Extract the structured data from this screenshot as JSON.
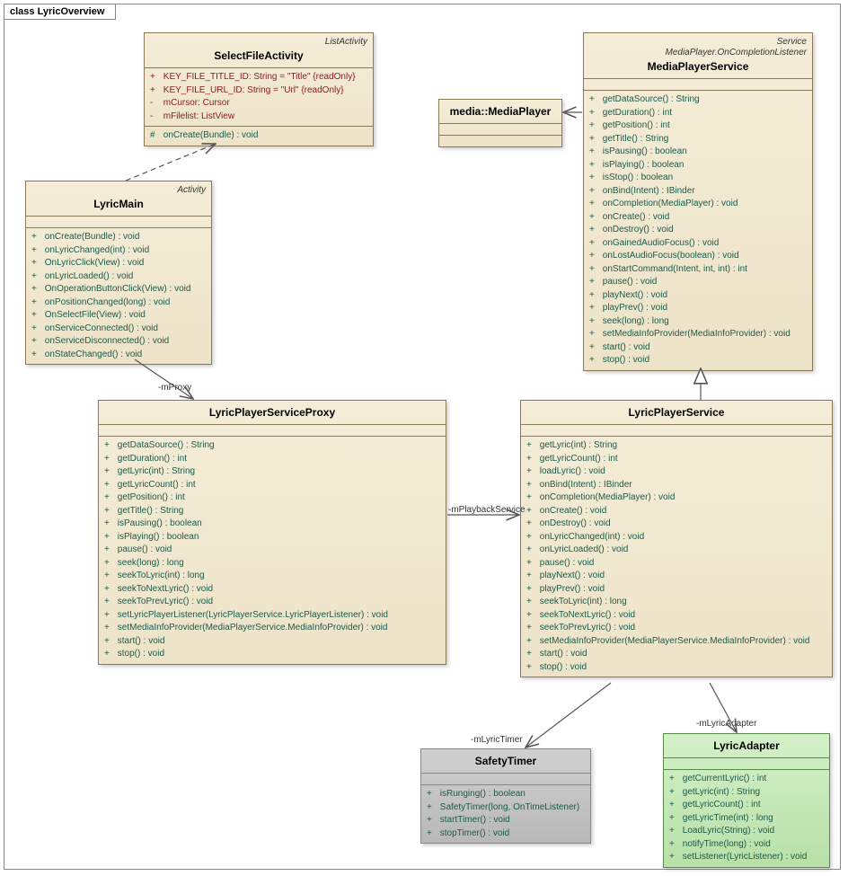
{
  "frame": {
    "title": "class LyricOverview"
  },
  "SelectFileActivity": {
    "stereo": "ListActivity",
    "name": "SelectFileActivity",
    "attrs": [
      {
        "vis": "+",
        "txt": "KEY_FILE_TITLE_ID:  String = \"Title\" {readOnly}",
        "red": true
      },
      {
        "vis": "+",
        "txt": "KEY_FILE_URL_ID:  String = \"Url\" {readOnly}",
        "red": true
      },
      {
        "vis": "-",
        "txt": "mCursor:  Cursor",
        "red": true
      },
      {
        "vis": "-",
        "txt": "mFilelist:  ListView",
        "red": true
      }
    ],
    "ops": [
      {
        "vis": "#",
        "txt": "onCreate(Bundle) : void"
      }
    ]
  },
  "LyricMain": {
    "stereo": "Activity",
    "name": "LyricMain",
    "ops": [
      {
        "vis": "+",
        "txt": "onCreate(Bundle) : void"
      },
      {
        "vis": "+",
        "txt": "onLyricChanged(int) : void"
      },
      {
        "vis": "+",
        "txt": "OnLyricClick(View) : void"
      },
      {
        "vis": "+",
        "txt": "onLyricLoaded() : void"
      },
      {
        "vis": "+",
        "txt": "OnOperationButtonClick(View) : void"
      },
      {
        "vis": "+",
        "txt": "onPositionChanged(long) : void"
      },
      {
        "vis": "+",
        "txt": "OnSelectFile(View) : void"
      },
      {
        "vis": "+",
        "txt": "onServiceConnected() : void"
      },
      {
        "vis": "+",
        "txt": "onServiceDisconnected() : void"
      },
      {
        "vis": "+",
        "txt": "onStateChanged() : void"
      }
    ]
  },
  "MediaPlayer": {
    "name": "media::MediaPlayer"
  },
  "MediaPlayerService": {
    "stereo1": "Service",
    "stereo2": "MediaPlayer.OnCompletionListener",
    "name": "MediaPlayerService",
    "ops": [
      {
        "vis": "+",
        "txt": "getDataSource() : String"
      },
      {
        "vis": "+",
        "txt": "getDuration() : int"
      },
      {
        "vis": "+",
        "txt": "getPosition() : int"
      },
      {
        "vis": "+",
        "txt": "getTitle() : String"
      },
      {
        "vis": "+",
        "txt": "isPausing() : boolean"
      },
      {
        "vis": "+",
        "txt": "isPlaying() : boolean"
      },
      {
        "vis": "+",
        "txt": "isStop() : boolean"
      },
      {
        "vis": "+",
        "txt": "onBind(Intent) : IBinder"
      },
      {
        "vis": "+",
        "txt": "onCompletion(MediaPlayer) : void"
      },
      {
        "vis": "+",
        "txt": "onCreate() : void"
      },
      {
        "vis": "+",
        "txt": "onDestroy() : void"
      },
      {
        "vis": "+",
        "txt": "onGainedAudioFocus() : void"
      },
      {
        "vis": "+",
        "txt": "onLostAudioFocus(boolean) : void"
      },
      {
        "vis": "+",
        "txt": "onStartCommand(Intent, int, int) : int"
      },
      {
        "vis": "+",
        "txt": "pause() : void"
      },
      {
        "vis": "+",
        "txt": "playNext() : void"
      },
      {
        "vis": "+",
        "txt": "playPrev() : void"
      },
      {
        "vis": "+",
        "txt": "seek(long) : long"
      },
      {
        "vis": "+",
        "txt": "setMediaInfoProvider(MediaInfoProvider) : void"
      },
      {
        "vis": "+",
        "txt": "start() : void"
      },
      {
        "vis": "+",
        "txt": "stop() : void"
      }
    ]
  },
  "LyricPlayerServiceProxy": {
    "name": "LyricPlayerServiceProxy",
    "ops": [
      {
        "vis": "+",
        "txt": "getDataSource() : String"
      },
      {
        "vis": "+",
        "txt": "getDuration() : int"
      },
      {
        "vis": "+",
        "txt": "getLyric(int) : String"
      },
      {
        "vis": "+",
        "txt": "getLyricCount() : int"
      },
      {
        "vis": "+",
        "txt": "getPosition() : int"
      },
      {
        "vis": "+",
        "txt": "getTitle() : String"
      },
      {
        "vis": "+",
        "txt": "isPausing() : boolean"
      },
      {
        "vis": "+",
        "txt": "isPlaying() : boolean"
      },
      {
        "vis": "+",
        "txt": "pause() : void"
      },
      {
        "vis": "+",
        "txt": "seek(long) : long"
      },
      {
        "vis": "+",
        "txt": "seekToLyric(int) : long"
      },
      {
        "vis": "+",
        "txt": "seekToNextLyric() : void"
      },
      {
        "vis": "+",
        "txt": "seekToPrevLyric() : void"
      },
      {
        "vis": "+",
        "txt": "setLyricPlayerListener(LyricPlayerService.LyricPlayerListener) : void"
      },
      {
        "vis": "+",
        "txt": "setMediaInfoProvider(MediaPlayerService.MediaInfoProvider) : void"
      },
      {
        "vis": "+",
        "txt": "start() : void"
      },
      {
        "vis": "+",
        "txt": "stop() : void"
      }
    ]
  },
  "LyricPlayerService": {
    "name": "LyricPlayerService",
    "ops": [
      {
        "vis": "+",
        "txt": "getLyric(int) : String"
      },
      {
        "vis": "+",
        "txt": "getLyricCount() : int"
      },
      {
        "vis": "+",
        "txt": "loadLyric() : void"
      },
      {
        "vis": "+",
        "txt": "onBind(Intent) : IBinder"
      },
      {
        "vis": "+",
        "txt": "onCompletion(MediaPlayer) : void"
      },
      {
        "vis": "+",
        "txt": "onCreate() : void"
      },
      {
        "vis": "+",
        "txt": "onDestroy() : void"
      },
      {
        "vis": "+",
        "txt": "onLyricChanged(int) : void"
      },
      {
        "vis": "+",
        "txt": "onLyricLoaded() : void"
      },
      {
        "vis": "+",
        "txt": "pause() : void"
      },
      {
        "vis": "+",
        "txt": "playNext() : void"
      },
      {
        "vis": "+",
        "txt": "playPrev() : void"
      },
      {
        "vis": "+",
        "txt": "seekToLyric(int) : long"
      },
      {
        "vis": "+",
        "txt": "seekToNextLyric() : void"
      },
      {
        "vis": "+",
        "txt": "seekToPrevLyric() : void"
      },
      {
        "vis": "+",
        "txt": "setMediaInfoProvider(MediaPlayerService.MediaInfoProvider) : void"
      },
      {
        "vis": "+",
        "txt": "start() : void"
      },
      {
        "vis": "+",
        "txt": "stop() : void"
      }
    ]
  },
  "SafetyTimer": {
    "name": "SafetyTimer",
    "ops": [
      {
        "vis": "+",
        "txt": "isRunging() : boolean"
      },
      {
        "vis": "+",
        "txt": "SafetyTimer(long, OnTimeListener)"
      },
      {
        "vis": "+",
        "txt": "startTimer() : void"
      },
      {
        "vis": "+",
        "txt": "stopTimer() : void"
      }
    ]
  },
  "LyricAdapter": {
    "name": "LyricAdapter",
    "ops": [
      {
        "vis": "+",
        "txt": "getCurrentLyric() : int"
      },
      {
        "vis": "+",
        "txt": "getLyric(int) : String"
      },
      {
        "vis": "+",
        "txt": "getLyricCount() : int"
      },
      {
        "vis": "+",
        "txt": "getLyricTime(int) : long"
      },
      {
        "vis": "+",
        "txt": "LoadLyric(String) : void"
      },
      {
        "vis": "+",
        "txt": "notifyTime(long) : void"
      },
      {
        "vis": "+",
        "txt": "setListener(LyricListener) : void"
      }
    ]
  },
  "labels": {
    "mProxy": "-mProxy",
    "mPlaybackService": "-mPlaybackService",
    "mLyricTimer": "-mLyricTimer",
    "mLyricAdapter": "-mLyricAdapter"
  }
}
